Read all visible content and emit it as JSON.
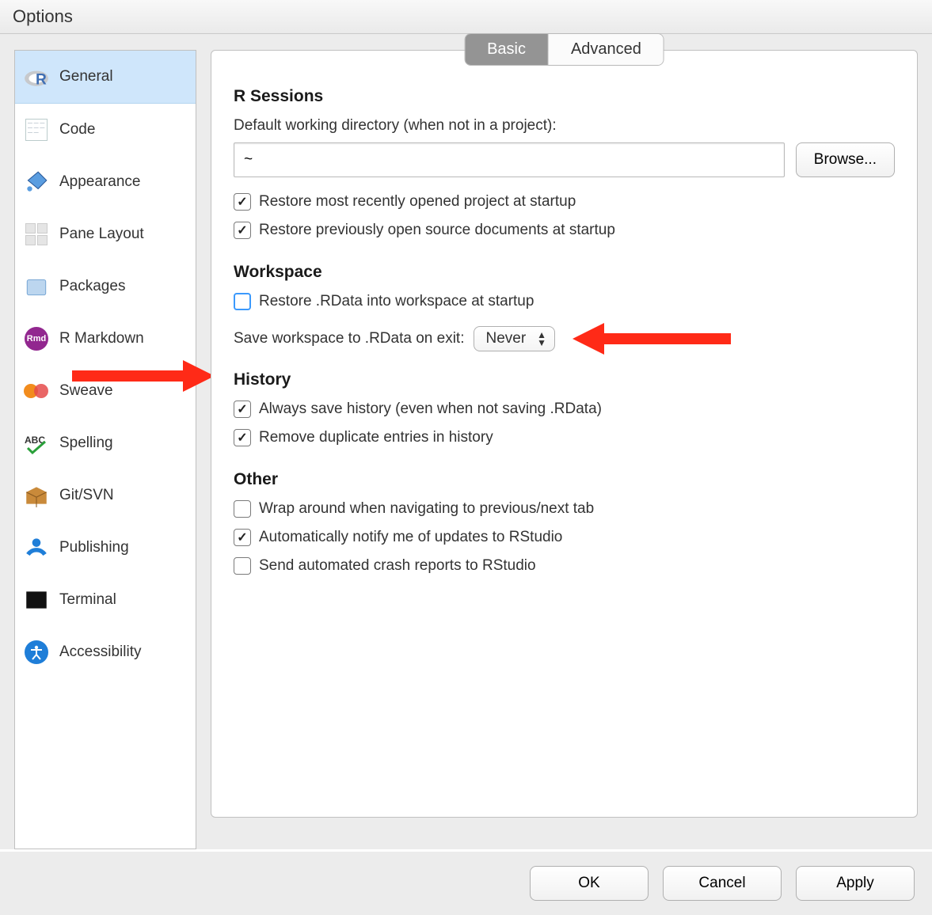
{
  "title": "Options",
  "sidebar": {
    "items": [
      {
        "label": "General",
        "selected": true
      },
      {
        "label": "Code"
      },
      {
        "label": "Appearance"
      },
      {
        "label": "Pane Layout"
      },
      {
        "label": "Packages"
      },
      {
        "label": "R Markdown"
      },
      {
        "label": "Sweave"
      },
      {
        "label": "Spelling"
      },
      {
        "label": "Git/SVN"
      },
      {
        "label": "Publishing"
      },
      {
        "label": "Terminal"
      },
      {
        "label": "Accessibility"
      }
    ]
  },
  "tabs": {
    "basic": "Basic",
    "advanced": "Advanced"
  },
  "sections": {
    "rsessions": {
      "title": "R Sessions",
      "workdir_label": "Default working directory (when not in a project):",
      "workdir_value": "~",
      "browse": "Browse...",
      "restore_project": "Restore most recently opened project at startup",
      "restore_docs": "Restore previously open source documents at startup"
    },
    "workspace": {
      "title": "Workspace",
      "restore_rdata": "Restore .RData into workspace at startup",
      "save_label": "Save workspace to .RData on exit:",
      "save_value": "Never"
    },
    "history": {
      "title": "History",
      "always_save": "Always save history (even when not saving .RData)",
      "remove_dupes": "Remove duplicate entries in history"
    },
    "other": {
      "title": "Other",
      "wrap_tabs": "Wrap around when navigating to previous/next tab",
      "notify_updates": "Automatically notify me of updates to RStudio",
      "crash_reports": "Send automated crash reports to RStudio"
    }
  },
  "footer": {
    "ok": "OK",
    "cancel": "Cancel",
    "apply": "Apply"
  }
}
